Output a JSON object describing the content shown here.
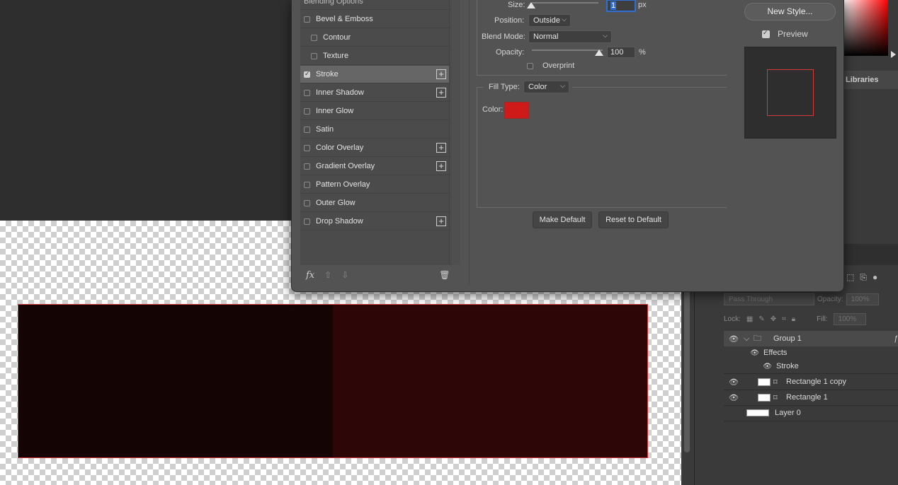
{
  "dialog": {
    "styles": {
      "header": "Blending Options",
      "items": [
        {
          "label": "Bevel & Emboss",
          "checked": false,
          "indent": false,
          "plus": false,
          "selected": false
        },
        {
          "label": "Contour",
          "checked": false,
          "indent": true,
          "plus": false,
          "selected": false
        },
        {
          "label": "Texture",
          "checked": false,
          "indent": true,
          "plus": false,
          "selected": false
        },
        {
          "label": "Stroke",
          "checked": true,
          "indent": false,
          "plus": true,
          "selected": true
        },
        {
          "label": "Inner Shadow",
          "checked": false,
          "indent": false,
          "plus": true,
          "selected": false
        },
        {
          "label": "Inner Glow",
          "checked": false,
          "indent": false,
          "plus": false,
          "selected": false
        },
        {
          "label": "Satin",
          "checked": false,
          "indent": false,
          "plus": false,
          "selected": false
        },
        {
          "label": "Color Overlay",
          "checked": false,
          "indent": false,
          "plus": true,
          "selected": false
        },
        {
          "label": "Gradient Overlay",
          "checked": false,
          "indent": false,
          "plus": true,
          "selected": false
        },
        {
          "label": "Pattern Overlay",
          "checked": false,
          "indent": false,
          "plus": false,
          "selected": false
        },
        {
          "label": "Outer Glow",
          "checked": false,
          "indent": false,
          "plus": false,
          "selected": false
        },
        {
          "label": "Drop Shadow",
          "checked": false,
          "indent": false,
          "plus": true,
          "selected": false
        }
      ],
      "footer_fx": "fx"
    },
    "stroke": {
      "size_label": "Size:",
      "size_value": "1",
      "size_unit": "px",
      "position_label": "Position:",
      "position_value": "Outside",
      "blend_mode_label": "Blend Mode:",
      "blend_mode_value": "Normal",
      "opacity_label": "Opacity:",
      "opacity_value": "100",
      "opacity_unit": "%",
      "overprint_label": "Overprint",
      "fill_type_label": "Fill Type:",
      "fill_type_value": "Color",
      "color_label": "Color:",
      "color_hex": "#cf1a1a"
    },
    "buttons": {
      "make_default": "Make Default",
      "reset_default": "Reset to Default",
      "new_style": "New Style...",
      "preview_label": "Preview"
    }
  },
  "panels": {
    "libraries_tab": "Libraries",
    "blend_mode": "Pass Through",
    "opacity_label": "Opacity:",
    "opacity_value": "100%",
    "lock_label": "Lock:",
    "fill_label": "Fill:",
    "fill_value": "100%"
  },
  "layers": [
    {
      "name": "Group 1",
      "type": "group"
    },
    {
      "name": "Effects",
      "type": "effects"
    },
    {
      "name": "Stroke",
      "type": "effect"
    },
    {
      "name": "Rectangle 1 copy",
      "type": "shape"
    },
    {
      "name": "Rectangle 1",
      "type": "shape"
    },
    {
      "name": "Layer 0",
      "type": "pixel"
    }
  ],
  "colors": {
    "stroke_red": "#d33a3a",
    "rect_left": "#150404",
    "rect_right": "#2d0707"
  }
}
